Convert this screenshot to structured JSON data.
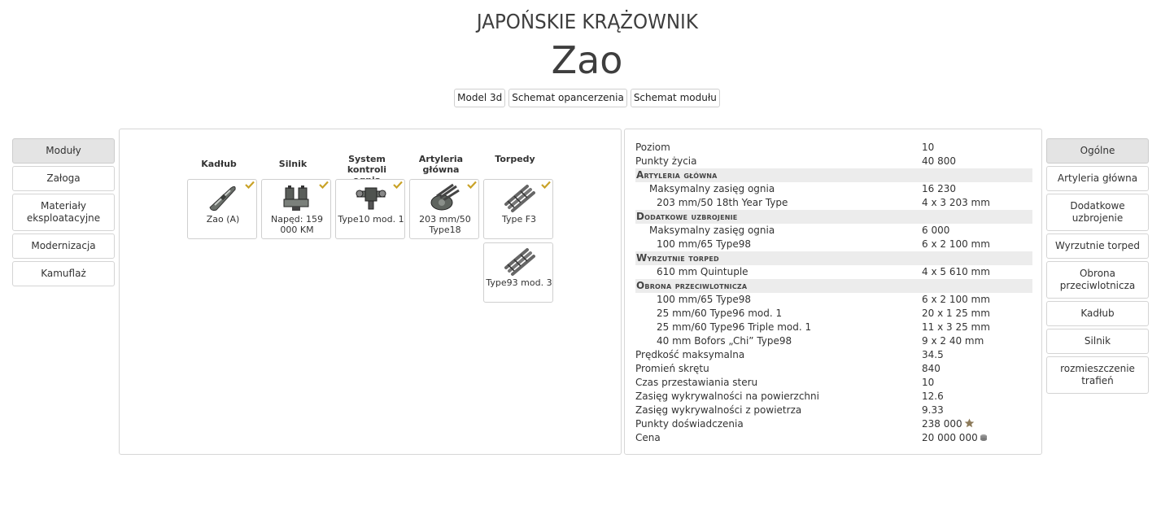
{
  "header": {
    "nation_class": "JAPOŃSKIE KRĄŻOWNIK",
    "ship_name": "Zao"
  },
  "top_buttons": [
    "Model 3d",
    "Schemat opancerzenia",
    "Schemat modułu"
  ],
  "left_nav": {
    "items": [
      {
        "label": "Moduły",
        "active": true
      },
      {
        "label": "Załoga",
        "active": false
      },
      {
        "label": "Materiały eksploatacyjne",
        "active": false
      },
      {
        "label": "Modernizacja",
        "active": false
      },
      {
        "label": "Kamuflaż",
        "active": false
      }
    ]
  },
  "right_nav": {
    "items": [
      {
        "label": "Ogólne",
        "active": true
      },
      {
        "label": "Artyleria główna",
        "active": false
      },
      {
        "label": "Dodatkowe uzbrojenie",
        "active": false
      },
      {
        "label": "Wyrzutnie torped",
        "active": false
      },
      {
        "label": "Obrona przeciwlotnicza",
        "active": false
      },
      {
        "label": "Kadłub",
        "active": false
      },
      {
        "label": "Silnik",
        "active": false
      },
      {
        "label": "rozmieszczenie trafień",
        "active": false
      }
    ]
  },
  "modules": {
    "columns": [
      {
        "title": "Kadłub",
        "icon": "hull-icon",
        "cards": [
          {
            "label": "Zao (A)",
            "selected": true
          }
        ]
      },
      {
        "title": "Silnik",
        "icon": "engine-icon",
        "cards": [
          {
            "label": "Napęd: 159 000 KM",
            "selected": true
          }
        ]
      },
      {
        "title": "System kontroli ognia",
        "icon": "fire-control-icon",
        "cards": [
          {
            "label": "Type10 mod. 1",
            "selected": true
          }
        ]
      },
      {
        "title": "Artyleria główna",
        "icon": "main-battery-icon",
        "cards": [
          {
            "label": "203 mm/50 Type18",
            "selected": true
          }
        ]
      },
      {
        "title": "Torpedy",
        "icon": "torpedo-icon",
        "cards": [
          {
            "label": "Type F3",
            "selected": true
          },
          {
            "label": "Type93 mod. 3",
            "selected": false
          }
        ]
      }
    ]
  },
  "stats": {
    "rows": [
      {
        "kind": "main",
        "key": "Poziom",
        "value": "10"
      },
      {
        "kind": "main",
        "key": "Punkty życia",
        "value": "40 800"
      },
      {
        "kind": "section",
        "key": "Artyleria główna",
        "value": ""
      },
      {
        "kind": "i1",
        "key": "Maksymalny zasięg ognia",
        "value": "16 230"
      },
      {
        "kind": "i2",
        "key": "203 mm/50 18th Year Type",
        "value": "4 x 3 203 mm"
      },
      {
        "kind": "section",
        "key": "Dodatkowe uzbrojenie",
        "value": ""
      },
      {
        "kind": "i1",
        "key": "Maksymalny zasięg ognia",
        "value": "6 000"
      },
      {
        "kind": "i2",
        "key": "100 mm/65 Type98",
        "value": "6 x 2 100 mm"
      },
      {
        "kind": "section",
        "key": "Wyrzutnie torped",
        "value": ""
      },
      {
        "kind": "i2",
        "key": "610 mm Quintuple",
        "value": "4 x 5 610 mm"
      },
      {
        "kind": "section",
        "key": "Obrona przeciwlotnicza",
        "value": ""
      },
      {
        "kind": "i2",
        "key": "100 mm/65 Type98",
        "value": "6 x 2 100 mm"
      },
      {
        "kind": "i2",
        "key": "25 mm/60 Type96 mod. 1",
        "value": "20 x 1 25 mm"
      },
      {
        "kind": "i2",
        "key": "25 mm/60 Type96 Triple mod. 1",
        "value": "11 x 3 25 mm"
      },
      {
        "kind": "i2",
        "key": "40 mm Bofors „Chi” Type98",
        "value": "9 x 2 40 mm"
      },
      {
        "kind": "main",
        "key": "Prędkość maksymalna",
        "value": "34.5"
      },
      {
        "kind": "main",
        "key": "Promień skrętu",
        "value": "840"
      },
      {
        "kind": "main",
        "key": "Czas przestawiania steru",
        "value": "10"
      },
      {
        "kind": "main",
        "key": "Zasięg wykrywalności na powierzchni",
        "value": "12.6"
      },
      {
        "kind": "main",
        "key": "Zasięg wykrywalności z powietrza",
        "value": "9.33"
      },
      {
        "kind": "main",
        "key": "Punkty doświadczenia",
        "value": "238 000",
        "icon": "xp-star-icon"
      },
      {
        "kind": "main",
        "key": "Cena",
        "value": "20 000 000",
        "icon": "credits-icon"
      }
    ]
  },
  "colors": {
    "active_nav_bg": "#e4e4e4",
    "section_bg": "#ececec",
    "check": "#c9a227",
    "title_text": "#3e3e3e"
  }
}
